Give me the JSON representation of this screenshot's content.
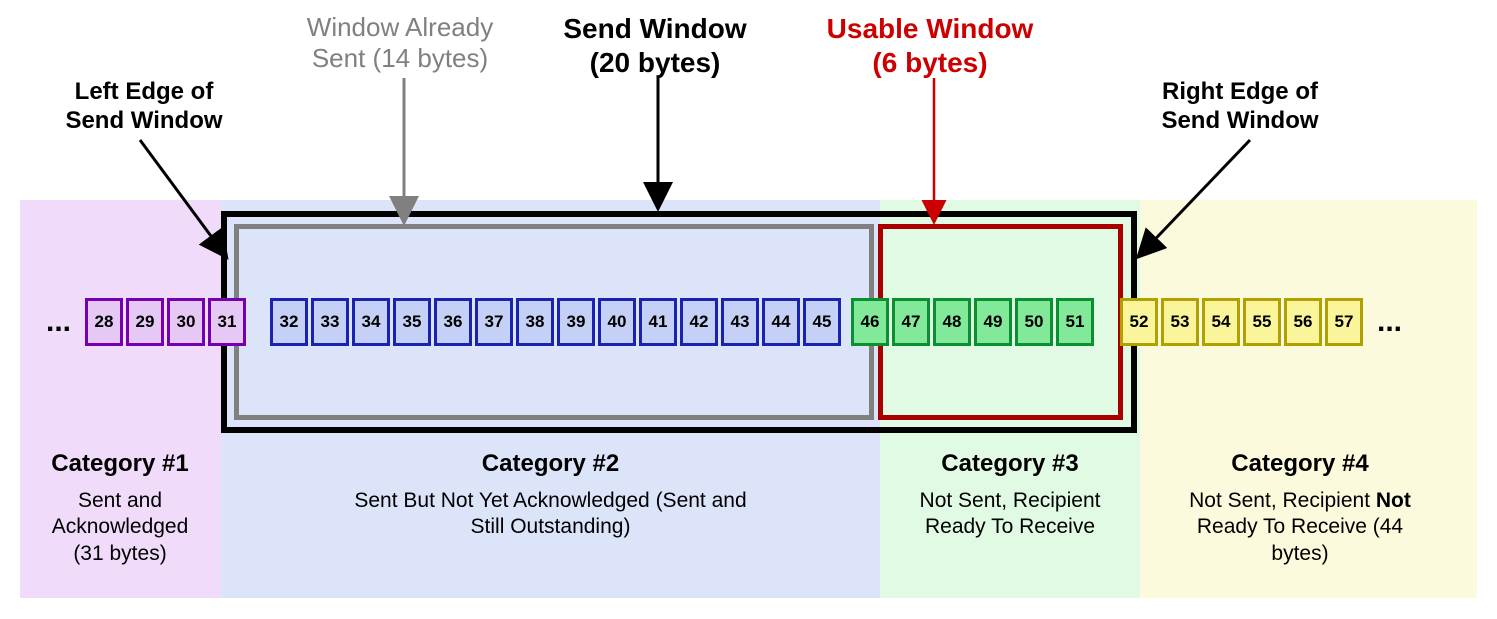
{
  "labels": {
    "left_edge_l1": "Left Edge of",
    "left_edge_l2": "Send Window",
    "already_sent_l1": "Window Already",
    "already_sent_l2": "Sent (14 bytes)",
    "send_window_l1": "Send Window",
    "send_window_l2": "(20 bytes)",
    "usable_window_l1": "Usable Window",
    "usable_window_l2": "(6 bytes)",
    "right_edge_l1": "Right Edge of",
    "right_edge_l2": "Send Window"
  },
  "categories": {
    "c1": {
      "title": "Category #1",
      "desc": "Sent and Acknowledged (31 bytes)"
    },
    "c2": {
      "title": "Category #2",
      "desc": "Sent But Not Yet Acknowledged (Sent and Still Outstanding)"
    },
    "c3": {
      "title": "Category #3",
      "desc": "Not Sent, Recipient Ready To Receive"
    },
    "c4": {
      "title": "Category #4",
      "desc_pre": "Not Sent, Recipient ",
      "desc_bold": "Not",
      "desc_post": " Ready To Receive (44 bytes)"
    }
  },
  "bytes": {
    "c1": [
      "28",
      "29",
      "30",
      "31"
    ],
    "c2": [
      "32",
      "33",
      "34",
      "35",
      "36",
      "37",
      "38",
      "39",
      "40",
      "41",
      "42",
      "43",
      "44",
      "45"
    ],
    "c3": [
      "46",
      "47",
      "48",
      "49",
      "50",
      "51"
    ],
    "c4": [
      "52",
      "53",
      "54",
      "55",
      "56",
      "57"
    ]
  },
  "chart_data": {
    "type": "table",
    "title": "TCP Sliding Send Window byte categories",
    "send_window_bytes": 20,
    "window_already_sent_bytes": 14,
    "usable_window_bytes": 6,
    "left_edge_byte": 32,
    "right_edge_byte": 51,
    "categories": [
      {
        "id": 1,
        "name": "Sent and Acknowledged",
        "bytes": 31,
        "visible_range": [
          28,
          31
        ]
      },
      {
        "id": 2,
        "name": "Sent But Not Yet Acknowledged (Sent and Still Outstanding)",
        "bytes": 14,
        "visible_range": [
          32,
          45
        ]
      },
      {
        "id": 3,
        "name": "Not Sent, Recipient Ready To Receive",
        "bytes": 6,
        "visible_range": [
          46,
          51
        ]
      },
      {
        "id": 4,
        "name": "Not Sent, Recipient Not Ready To Receive",
        "bytes": 44,
        "visible_range": [
          52,
          57
        ]
      }
    ]
  },
  "ellipsis": "..."
}
